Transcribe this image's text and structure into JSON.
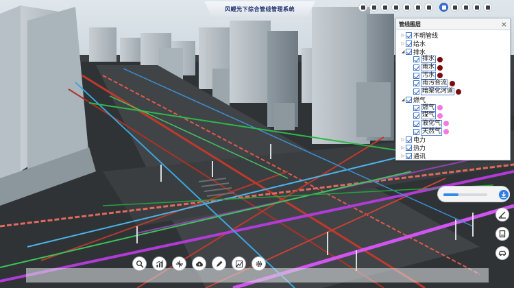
{
  "app": {
    "title": "风鲤光下综合管线管理系统"
  },
  "top_toolbar": {
    "buttons": [
      {
        "icon": "info-icon"
      },
      {
        "icon": "location-pin-icon"
      },
      {
        "icon": "bar-chart-icon"
      },
      {
        "icon": "ruler-icon"
      },
      {
        "icon": "target-icon"
      },
      {
        "icon": "swap-icon"
      },
      {
        "icon": "pencil-icon"
      },
      {
        "icon": "layers-icon",
        "active": true
      },
      {
        "icon": "settings-icon"
      },
      {
        "icon": "camera-icon"
      },
      {
        "icon": "grid-icon"
      },
      {
        "icon": "reset-icon"
      }
    ]
  },
  "layer_panel": {
    "title": "管线图层",
    "close_glyph": "×",
    "items": [
      {
        "label": "不明管线",
        "level": 1,
        "expander": "collapsed"
      },
      {
        "label": "给水",
        "level": 1,
        "expander": "collapsed"
      },
      {
        "label": "排水",
        "level": 1,
        "expander": "expanded"
      },
      {
        "label": "排水",
        "level": 2,
        "dot": "#7a0c0c"
      },
      {
        "label": "雨水",
        "level": 2,
        "dot": "#7a0c0c"
      },
      {
        "label": "污水",
        "level": 2,
        "dot": "#7a0c0c"
      },
      {
        "label": "雨污合流",
        "level": 2,
        "dot": "#7a0c0c"
      },
      {
        "label": "暗渠化河道",
        "level": 2,
        "dot": "#7a0c0c"
      },
      {
        "label": "燃气",
        "level": 1,
        "expander": "expanded"
      },
      {
        "label": "燃气",
        "level": 2,
        "dot": "#f27ae0"
      },
      {
        "label": "煤气",
        "level": 2,
        "dot": "#f27ae0"
      },
      {
        "label": "液化气",
        "level": 2,
        "dot": "#f27ae0"
      },
      {
        "label": "天然气",
        "level": 2,
        "dot": "#f27ae0"
      },
      {
        "label": "电力",
        "level": 1,
        "expander": "collapsed"
      },
      {
        "label": "热力",
        "level": 1,
        "expander": "collapsed"
      },
      {
        "label": "通讯",
        "level": 1,
        "expander": "collapsed"
      }
    ]
  },
  "slider": {
    "value": 0.35,
    "knob_icon": "download-icon"
  },
  "side_tools": [
    {
      "name": "measure-angle-button",
      "icon": "angle-icon"
    },
    {
      "name": "document-button",
      "icon": "document-icon"
    },
    {
      "name": "vehicle-button",
      "icon": "car-icon"
    }
  ],
  "bottom_tools": [
    {
      "name": "search-button",
      "icon": "search-icon"
    },
    {
      "name": "statistics-button",
      "icon": "chart-icon"
    },
    {
      "name": "cross-section-button",
      "icon": "section-icon"
    },
    {
      "name": "cloud-upload-button",
      "icon": "cloud-icon"
    },
    {
      "name": "draw-button",
      "icon": "pencil-icon"
    },
    {
      "name": "analysis-chart-button",
      "icon": "area-chart-icon"
    },
    {
      "name": "settings-button",
      "icon": "gear-icon"
    }
  ],
  "pipe_colors": {
    "drainage": "#c0392b",
    "gas": "#b13bd6",
    "water": "#3aa8e0",
    "telecom": "#2fb84a",
    "road": "#4a4e52"
  }
}
